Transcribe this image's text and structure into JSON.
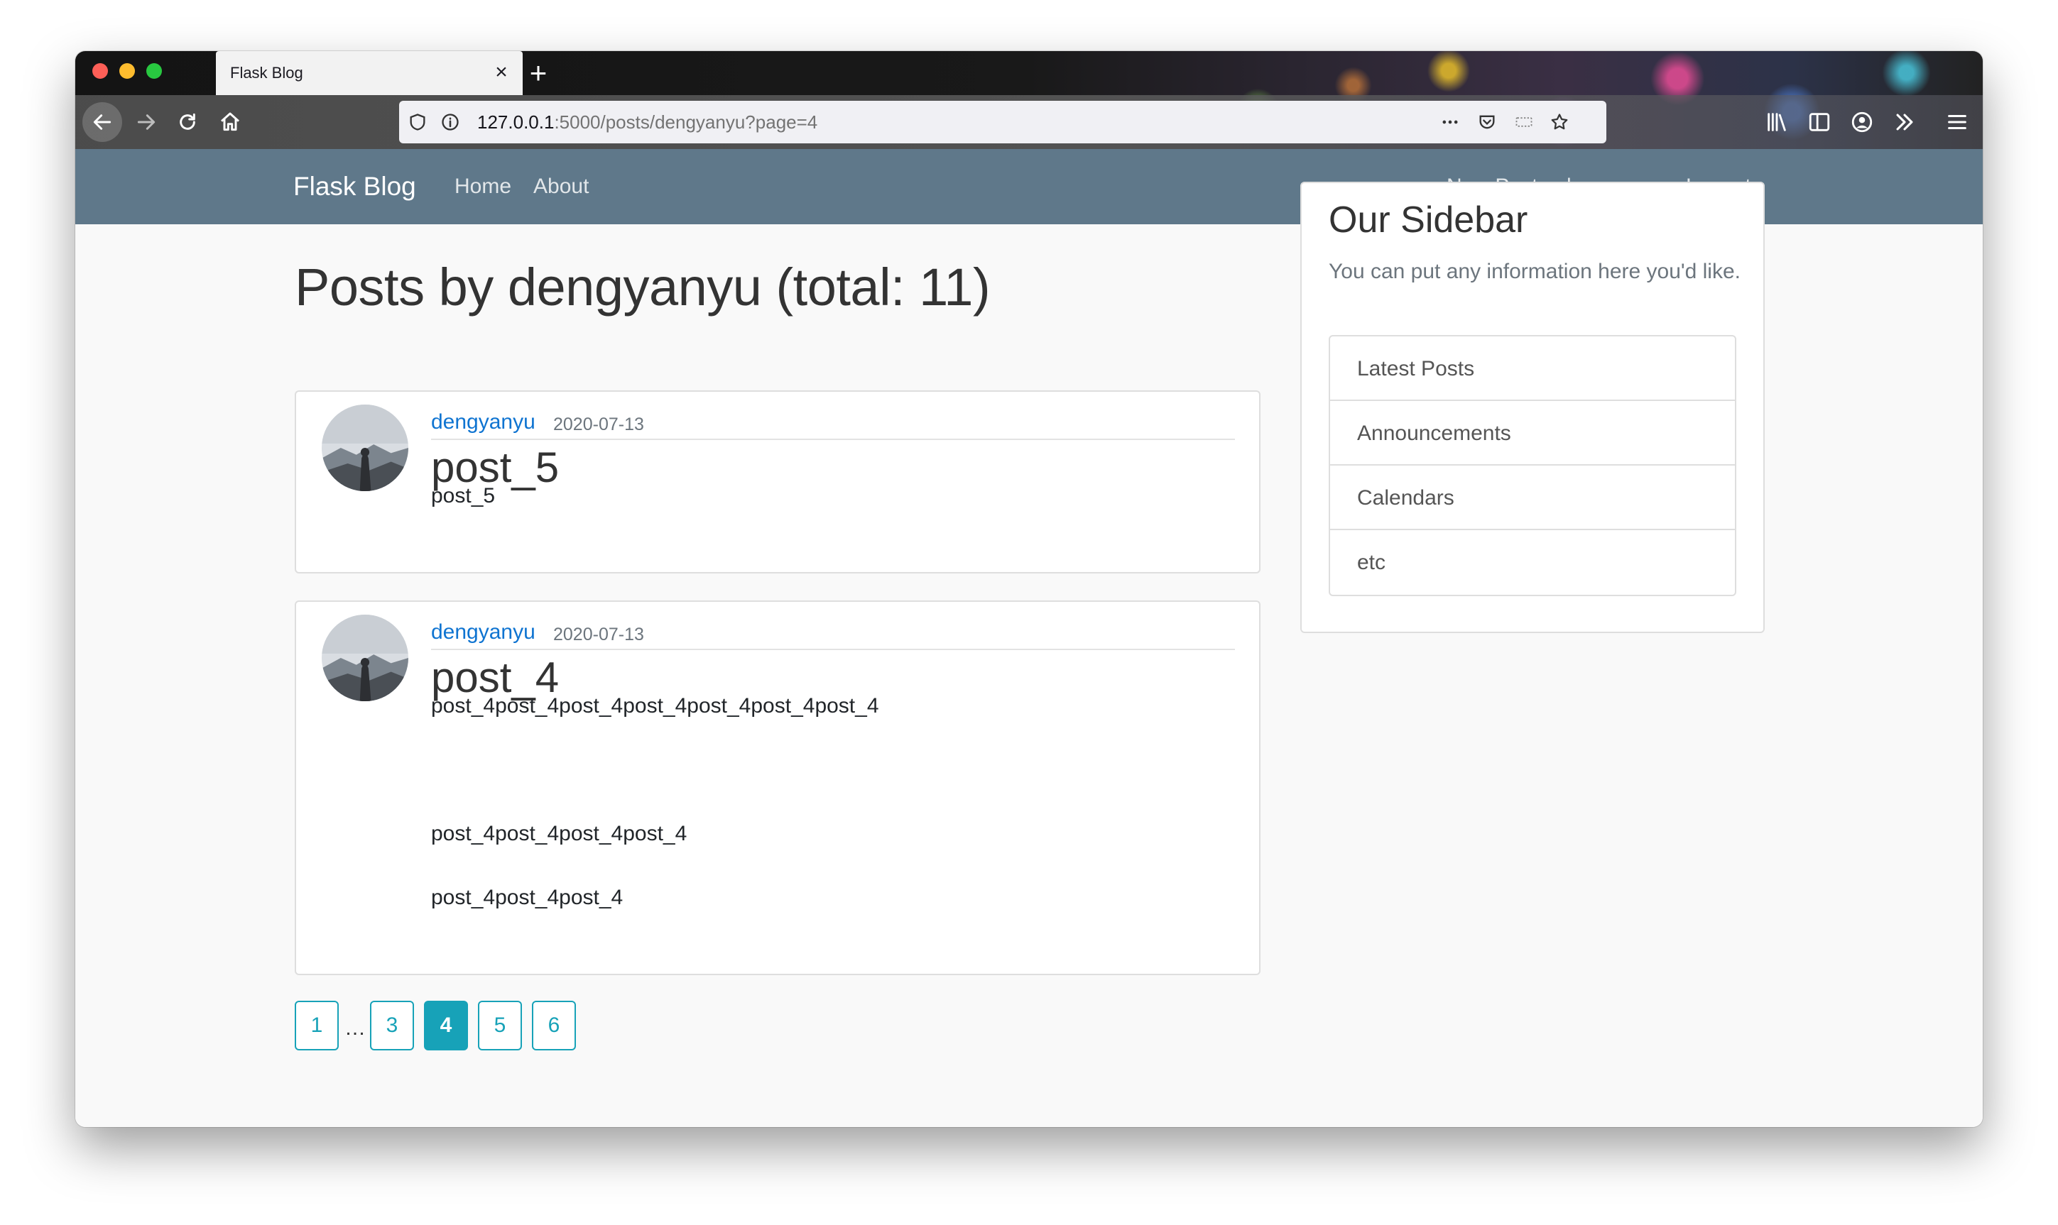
{
  "browser": {
    "tab_title": "Flask Blog",
    "tab_close": "×",
    "new_tab": "+",
    "url_host": "127.0.0.1",
    "url_rest": ":5000/posts/dengyanyu?page=4"
  },
  "navbar": {
    "brand": "Flask Blog",
    "left_links": [
      "Home",
      "About"
    ],
    "right_links": [
      "New Post",
      "dengyanyu",
      "Logout"
    ]
  },
  "main": {
    "title": "Posts by dengyanyu (total: 11)",
    "posts": [
      {
        "author": "dengyanyu",
        "date": "2020-07-13",
        "title": "post_5",
        "lines": [
          "post_5"
        ]
      },
      {
        "author": "dengyanyu",
        "date": "2020-07-13",
        "title": "post_4",
        "lines": [
          "post_4post_4post_4post_4post_4post_4post_4",
          "post_4post_4post_4post_4",
          "post_4post_4post_4"
        ]
      }
    ]
  },
  "pagination": {
    "pages": [
      "1",
      "…",
      "3",
      "4",
      "5",
      "6"
    ],
    "active": "4"
  },
  "sidebar": {
    "title": "Our Sidebar",
    "text": "You can put any information here you'd like.",
    "items": [
      "Latest Posts",
      "Announcements",
      "Calendars",
      "etc"
    ]
  },
  "colors": {
    "navbar": "#5f788a",
    "link": "#0f74d1",
    "pager_accent": "#17a2b8"
  }
}
